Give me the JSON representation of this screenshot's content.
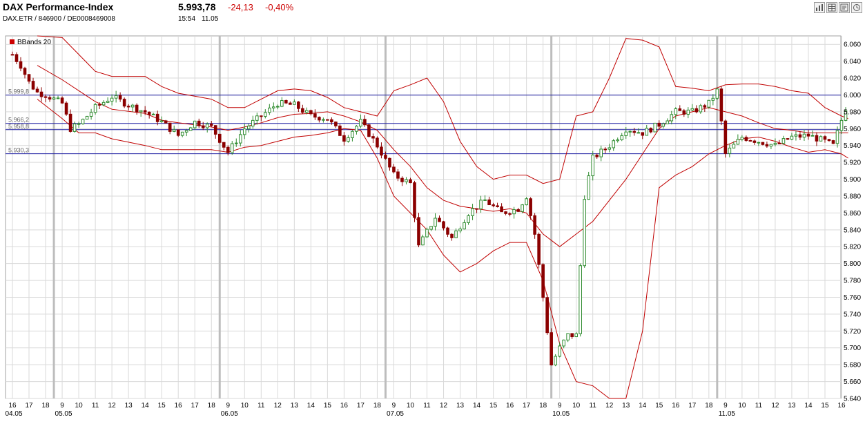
{
  "header": {
    "title": "DAX Performance-Index",
    "subtitle": "DAX.ETR  /  846900  /  DE0008469008",
    "price": "5.993,78",
    "change": "-24,13",
    "change_pct": "-0,40%",
    "time": "15:54",
    "date": "11.05"
  },
  "toolbar": {
    "icons": [
      "bar-chart-icon",
      "table-icon",
      "news-icon",
      "clock-icon"
    ]
  },
  "colors": {
    "candle_up": "#2e8b2e",
    "candle_down": "#8b0000",
    "bollinger": "#c00000",
    "reference_line": "#1a1aa0",
    "grid": "#d9d9d9",
    "day_separator": "#bdbdbd"
  },
  "chart_data": {
    "type": "candlestick",
    "legend": {
      "entries": [
        "BBands 20"
      ],
      "placement": "top-left"
    },
    "y_axis": {
      "position": "right",
      "range": [
        5640,
        6070
      ],
      "ticks": [
        5640,
        5660,
        5680,
        5700,
        5720,
        5740,
        5760,
        5780,
        5800,
        5820,
        5840,
        5860,
        5880,
        5900,
        5920,
        5940,
        5960,
        5980,
        6000,
        6020,
        6040,
        6060
      ],
      "tick_labels": [
        "5.640",
        "5.660",
        "5.680",
        "5.700",
        "5.720",
        "5.740",
        "5.760",
        "5.780",
        "5.800",
        "5.820",
        "5.840",
        "5.860",
        "5.880",
        "5.900",
        "5.920",
        "5.940",
        "5.960",
        "5.980",
        "6.000",
        "6.020",
        "6.040",
        "6.060"
      ]
    },
    "x_axis": {
      "hour_labels": [
        "16",
        "17",
        "18",
        "9",
        "10",
        "11",
        "12",
        "13",
        "14",
        "15",
        "16",
        "17",
        "18",
        "9",
        "10",
        "11",
        "12",
        "13",
        "14",
        "15",
        "16",
        "17",
        "18",
        "9",
        "10",
        "11",
        "12",
        "13",
        "14",
        "15",
        "16",
        "17",
        "18",
        "9",
        "10",
        "11",
        "12",
        "13",
        "14",
        "15",
        "16",
        "17",
        "18",
        "9",
        "10",
        "11",
        "12",
        "13",
        "14",
        "15",
        "16"
      ],
      "day_labels": [
        {
          "label": "04.05",
          "at_hour": 0
        },
        {
          "label": "05.05",
          "at_hour": 3
        },
        {
          "label": "06.05",
          "at_hour": 13
        },
        {
          "label": "07.05",
          "at_hour": 23
        },
        {
          "label": "10.05",
          "at_hour": 33
        },
        {
          "label": "11.05",
          "at_hour": 43
        }
      ],
      "grid": true
    },
    "reference_lines": [
      {
        "value": 5999.8,
        "label": "5.999,8"
      },
      {
        "value": 5966.2,
        "label": "5.966,2"
      },
      {
        "value": 5958.8,
        "label": "5.958,8"
      },
      {
        "value": 5930.3,
        "label": "5.930,3"
      }
    ],
    "price_profile": [
      [
        0.0,
        6048
      ],
      [
        0.5,
        6035
      ],
      [
        1.0,
        6015
      ],
      [
        1.5,
        6003
      ],
      [
        2.0,
        6000
      ],
      [
        3.0,
        5990
      ],
      [
        3.5,
        5960
      ],
      [
        4.0,
        5965
      ],
      [
        5.0,
        5985
      ],
      [
        6.0,
        5998
      ],
      [
        7.0,
        5988
      ],
      [
        8.0,
        5980
      ],
      [
        9.0,
        5968
      ],
      [
        10.0,
        5952
      ],
      [
        11.0,
        5968
      ],
      [
        12.0,
        5962
      ],
      [
        13.0,
        5932
      ],
      [
        14.0,
        5960
      ],
      [
        15.0,
        5975
      ],
      [
        16.0,
        5990
      ],
      [
        17.0,
        5988
      ],
      [
        18.0,
        5975
      ],
      [
        19.0,
        5972
      ],
      [
        20.0,
        5948
      ],
      [
        21.0,
        5968
      ],
      [
        22.0,
        5940
      ],
      [
        23.0,
        5905
      ],
      [
        24.0,
        5895
      ],
      [
        24.5,
        5820
      ],
      [
        25.5,
        5855
      ],
      [
        26.5,
        5830
      ],
      [
        27.5,
        5860
      ],
      [
        28.5,
        5875
      ],
      [
        29.5,
        5860
      ],
      [
        30.5,
        5865
      ],
      [
        31.0,
        5880
      ],
      [
        31.5,
        5835
      ],
      [
        32.0,
        5760
      ],
      [
        32.5,
        5680
      ],
      [
        33.0,
        5700
      ],
      [
        33.5,
        5715
      ],
      [
        34.0,
        5715
      ],
      [
        34.5,
        5880
      ],
      [
        35.0,
        5925
      ],
      [
        36.0,
        5940
      ],
      [
        37.0,
        5960
      ],
      [
        38.0,
        5955
      ],
      [
        39.0,
        5965
      ],
      [
        40.0,
        5980
      ],
      [
        41.0,
        5980
      ],
      [
        42.0,
        5990
      ],
      [
        42.5,
        6005
      ],
      [
        43.0,
        5930
      ],
      [
        44.0,
        5950
      ],
      [
        45.0,
        5945
      ],
      [
        46.0,
        5940
      ],
      [
        47.0,
        5950
      ],
      [
        48.0,
        5952
      ],
      [
        49.0,
        5945
      ],
      [
        49.5,
        5940
      ],
      [
        50.0,
        5970
      ],
      [
        50.4,
        5993
      ]
    ],
    "bollinger_upper": [
      [
        1.5,
        6080
      ],
      [
        3.0,
        6068
      ],
      [
        5.0,
        6028
      ],
      [
        6.0,
        6022
      ],
      [
        8.0,
        6022
      ],
      [
        9.0,
        6010
      ],
      [
        10.0,
        6002
      ],
      [
        12.0,
        5995
      ],
      [
        13.0,
        5985
      ],
      [
        14.0,
        5985
      ],
      [
        15.0,
        5995
      ],
      [
        16.0,
        6005
      ],
      [
        17.0,
        6007
      ],
      [
        18.0,
        6005
      ],
      [
        19.0,
        5997
      ],
      [
        20.0,
        5985
      ],
      [
        21.0,
        5980
      ],
      [
        22.0,
        5975
      ],
      [
        23.0,
        6005
      ],
      [
        24.0,
        6012
      ],
      [
        25.0,
        6020
      ],
      [
        26.0,
        5992
      ],
      [
        27.0,
        5945
      ],
      [
        28.0,
        5915
      ],
      [
        29.0,
        5900
      ],
      [
        30.0,
        5905
      ],
      [
        31.0,
        5905
      ],
      [
        32.0,
        5895
      ],
      [
        33.0,
        5900
      ],
      [
        34.0,
        5975
      ],
      [
        35.0,
        5980
      ],
      [
        36.0,
        6020
      ],
      [
        37.0,
        6067
      ],
      [
        38.0,
        6065
      ],
      [
        39.0,
        6057
      ],
      [
        40.0,
        6010
      ],
      [
        41.0,
        6008
      ],
      [
        42.0,
        6005
      ],
      [
        43.0,
        6012
      ],
      [
        44.0,
        6013
      ],
      [
        45.0,
        6013
      ],
      [
        46.0,
        6010
      ],
      [
        47.0,
        6005
      ],
      [
        48.0,
        6002
      ],
      [
        49.0,
        5985
      ],
      [
        50.0,
        5975
      ],
      [
        50.4,
        5972
      ]
    ],
    "bollinger_middle": [
      [
        1.5,
        6035
      ],
      [
        3.0,
        6018
      ],
      [
        5.0,
        5992
      ],
      [
        6.0,
        5983
      ],
      [
        8.0,
        5978
      ],
      [
        9.0,
        5970
      ],
      [
        10.0,
        5967
      ],
      [
        12.0,
        5962
      ],
      [
        13.0,
        5958
      ],
      [
        14.0,
        5962
      ],
      [
        15.0,
        5967
      ],
      [
        16.0,
        5973
      ],
      [
        17.0,
        5977
      ],
      [
        18.0,
        5978
      ],
      [
        19.0,
        5980
      ],
      [
        20.0,
        5975
      ],
      [
        21.0,
        5968
      ],
      [
        22.0,
        5958
      ],
      [
        23.0,
        5935
      ],
      [
        24.0,
        5915
      ],
      [
        25.0,
        5890
      ],
      [
        26.0,
        5875
      ],
      [
        27.0,
        5868
      ],
      [
        28.0,
        5865
      ],
      [
        29.0,
        5862
      ],
      [
        30.0,
        5865
      ],
      [
        31.0,
        5860
      ],
      [
        32.0,
        5835
      ],
      [
        33.0,
        5820
      ],
      [
        34.0,
        5835
      ],
      [
        35.0,
        5850
      ],
      [
        36.0,
        5875
      ],
      [
        37.0,
        5900
      ],
      [
        38.0,
        5930
      ],
      [
        39.0,
        5960
      ],
      [
        40.0,
        5975
      ],
      [
        41.0,
        5980
      ],
      [
        42.0,
        5985
      ],
      [
        43.0,
        5980
      ],
      [
        44.0,
        5975
      ],
      [
        45.0,
        5967
      ],
      [
        46.0,
        5960
      ],
      [
        47.0,
        5958
      ],
      [
        48.0,
        5955
      ],
      [
        49.0,
        5955
      ],
      [
        50.0,
        5955
      ],
      [
        50.4,
        5955
      ]
    ],
    "bollinger_lower": [
      [
        1.5,
        5995
      ],
      [
        3.0,
        5972
      ],
      [
        4.0,
        5955
      ],
      [
        5.0,
        5955
      ],
      [
        6.0,
        5948
      ],
      [
        8.0,
        5940
      ],
      [
        9.0,
        5935
      ],
      [
        10.0,
        5935
      ],
      [
        12.0,
        5935
      ],
      [
        13.0,
        5932
      ],
      [
        14.0,
        5938
      ],
      [
        15.0,
        5940
      ],
      [
        16.0,
        5945
      ],
      [
        17.0,
        5950
      ],
      [
        18.0,
        5952
      ],
      [
        19.0,
        5955
      ],
      [
        20.0,
        5960
      ],
      [
        21.0,
        5958
      ],
      [
        22.0,
        5925
      ],
      [
        23.0,
        5880
      ],
      [
        24.0,
        5860
      ],
      [
        25.0,
        5840
      ],
      [
        26.0,
        5810
      ],
      [
        27.0,
        5790
      ],
      [
        28.0,
        5800
      ],
      [
        29.0,
        5815
      ],
      [
        30.0,
        5825
      ],
      [
        31.0,
        5825
      ],
      [
        32.0,
        5780
      ],
      [
        33.0,
        5705
      ],
      [
        34.0,
        5660
      ],
      [
        35.0,
        5655
      ],
      [
        36.0,
        5640
      ],
      [
        37.0,
        5640
      ],
      [
        38.0,
        5720
      ],
      [
        39.0,
        5890
      ],
      [
        40.0,
        5905
      ],
      [
        41.0,
        5915
      ],
      [
        42.0,
        5930
      ],
      [
        43.0,
        5940
      ],
      [
        44.0,
        5948
      ],
      [
        45.0,
        5950
      ],
      [
        46.0,
        5945
      ],
      [
        47.0,
        5938
      ],
      [
        48.0,
        5932
      ],
      [
        49.0,
        5935
      ],
      [
        50.0,
        5930
      ],
      [
        50.4,
        5925
      ]
    ]
  }
}
